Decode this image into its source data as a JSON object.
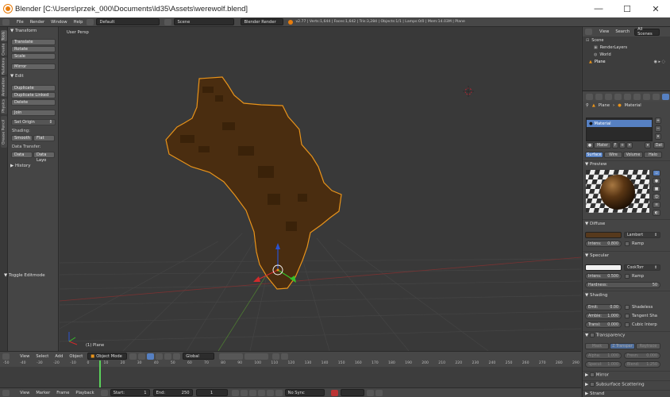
{
  "window": {
    "title": "Blender [C:\\Users\\przek_000\\Documents\\ld35\\Assets\\werewolf.blend]"
  },
  "colors": {
    "model": "#4a2d10",
    "outline": "#e8931a",
    "selected_tab": "#5680c2",
    "diffuse": "#56391c"
  },
  "infobar": {
    "menu": [
      "File",
      "Render",
      "Window",
      "Help"
    ],
    "layout": "Default",
    "scene": "Scene",
    "engine": "Blender Render",
    "stats": "v2.77 | Verts:1,644 | Faces:1,642 | Tris:3,284 | Objects:1/1 | Lamps:0/0 | Mem:14.03M | Plane"
  },
  "tabs": [
    "Tools",
    "Create",
    "Relations",
    "Animation",
    "Physics",
    "Grease Pencil"
  ],
  "toolshelf": {
    "transform": {
      "title": "Transform",
      "buttons": [
        "Translate",
        "Rotate",
        "Scale"
      ],
      "mirror": "Mirror"
    },
    "edit": {
      "title": "Edit",
      "buttons": [
        "Duplicate",
        "Duplicate Linked",
        "Delete"
      ],
      "join": "Join",
      "set_origin": "Set Origin",
      "shading_label": "Shading:",
      "smooth": "Smooth",
      "flat": "Flat",
      "data_transfer_label": "Data Transfer:",
      "data": "Data",
      "data_layouts": "Data Layo"
    },
    "history": "History",
    "toggle_editmode": "Toggle Editmode"
  },
  "viewport": {
    "view_label": "User Persp",
    "object_label": "(1) Plane"
  },
  "view3d_header": {
    "menus": [
      "View",
      "Select",
      "Add",
      "Object"
    ],
    "mode": "Object Mode",
    "orientation": "Global"
  },
  "timeline": {
    "ruler": [
      "-50",
      "-40",
      "-30",
      "-20",
      "-10",
      "0",
      "10",
      "20",
      "30",
      "40",
      "50",
      "60",
      "70",
      "80",
      "90",
      "100",
      "110",
      "120",
      "130",
      "140",
      "150",
      "160",
      "170",
      "180",
      "190",
      "200",
      "210",
      "220",
      "230",
      "240",
      "250",
      "260",
      "270",
      "280",
      "290"
    ],
    "menus": [
      "View",
      "Marker",
      "Frame",
      "Playback"
    ],
    "start_label": "Start:",
    "start": "1",
    "end_label": "End:",
    "end": "250",
    "current": "1",
    "sync": "No Sync"
  },
  "outliner": {
    "header_items": [
      "View",
      "Search",
      "All Scenes"
    ],
    "rows": [
      "Scene",
      "RenderLayers",
      "World",
      "Plane"
    ]
  },
  "properties": {
    "breadcrumb": [
      "Plane",
      "Material"
    ],
    "slot": "Material",
    "material_name": "Mater",
    "data_btn": "Dat",
    "tabs": [
      "Surface",
      "Wire",
      "Volume",
      "Halo"
    ],
    "preview_title": "Preview",
    "diffuse": {
      "title": "Diffuse",
      "shader": "Lambert",
      "intensity_label": "Intens:",
      "intensity": "0.800",
      "ramp": "Ramp"
    },
    "specular": {
      "title": "Specular",
      "shader": "CookTorr",
      "intensity_label": "Intens:",
      "intensity": "0.500",
      "ramp": "Ramp",
      "hardness_label": "Hardness:",
      "hardness": "50"
    },
    "shading": {
      "title": "Shading",
      "emit_label": "Emit:",
      "emit": "0.00",
      "ambient_label": "Ambie:",
      "ambient": "1.000",
      "translucency_label": "Transl:",
      "translucency": "0.000",
      "shadeless": "Shadeless",
      "tangent": "Tangent Sha",
      "cubic": "Cubic Interp"
    },
    "transparency": {
      "title": "Transparency",
      "modes": [
        "Mask",
        "Z Transpar",
        "Raytrace"
      ],
      "alpha_label": "Alpha:",
      "alpha": "1.000",
      "fresnel_label": "Fresn:",
      "fresnel": "0.000",
      "specular_label": "Specul:",
      "specular": "1.000",
      "blend_label": "Blend:",
      "blend": "1.250"
    },
    "collapsed": [
      "Mirror",
      "Subsurface Scattering",
      "Strand"
    ]
  }
}
